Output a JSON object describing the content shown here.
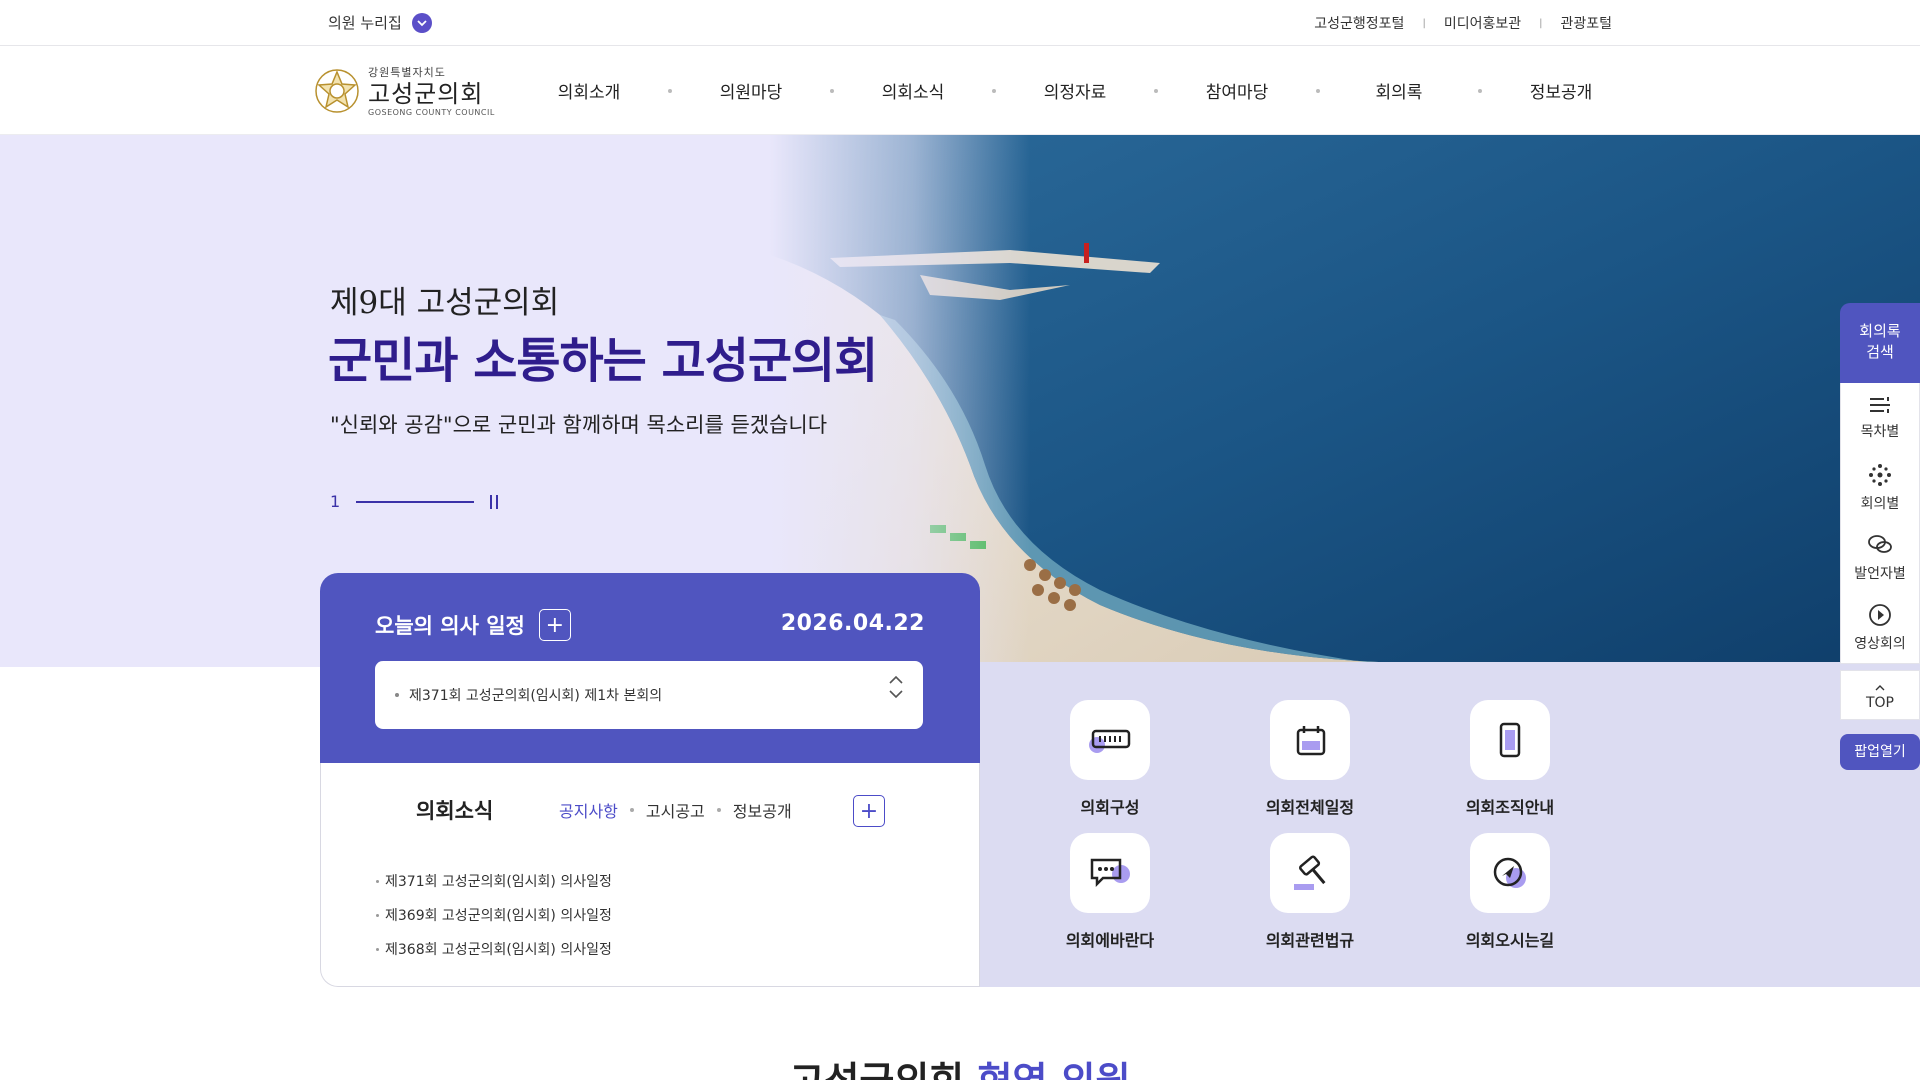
{
  "topbar": {
    "nuri_label": "의원 누리집",
    "links": [
      "고성군행정포털",
      "미디어홍보관",
      "관광포털"
    ]
  },
  "header": {
    "logo_small": "강원특별자치도",
    "logo_big": "고성군의회",
    "logo_eng": "GOSEONG COUNTY COUNCIL",
    "nav": [
      "의회소개",
      "의원마당",
      "의회소식",
      "의정자료",
      "참여마당",
      "회의록",
      "정보공개"
    ]
  },
  "hero": {
    "subtitle": "제9대 고성군의회",
    "title": "군민과 소통하는 고성군의회",
    "description": "\"신뢰와 공감\"으로 군민과 함께하며 목소리를 듣겠습니다",
    "slide_number": "1"
  },
  "schedule": {
    "title": "오늘의 의사 일정",
    "date": "2026.04.22",
    "item": "제371회 고성군의회(임시회) 제1차 본회의"
  },
  "news": {
    "title": "의회소식",
    "tabs": [
      "공지사항",
      "고시공고",
      "정보공개"
    ],
    "active_tab": "공지사항",
    "items": [
      "제371회 고성군의회(임시회) 의사일정",
      "제369회 고성군의회(임시회) 의사일정",
      "제368회 고성군의회(임시회) 의사일정"
    ]
  },
  "quick_links": [
    {
      "label": "의회구성",
      "icon": "keyboard-icon"
    },
    {
      "label": "의회전체일정",
      "icon": "calendar-icon"
    },
    {
      "label": "의회조직안내",
      "icon": "phone-icon"
    },
    {
      "label": "의회에바란다",
      "icon": "speech-bubble-icon"
    },
    {
      "label": "의회관련법규",
      "icon": "gavel-icon"
    },
    {
      "label": "의회오시는길",
      "icon": "compass-icon"
    }
  ],
  "floating": {
    "search_line1": "회의록",
    "search_line2": "검색",
    "menu": [
      "목차별",
      "회의별",
      "발언자별",
      "영상회의"
    ],
    "top_label": "TOP",
    "popup_label": "팝업열기"
  },
  "section": {
    "title_part1": "고성군의회",
    "title_part2": "현역 의원"
  },
  "colors": {
    "primary": "#5055bf",
    "hero_title": "#2f1d8c",
    "hero_bg": "#e9e7fb",
    "band_bg": "#dcdcf2"
  }
}
